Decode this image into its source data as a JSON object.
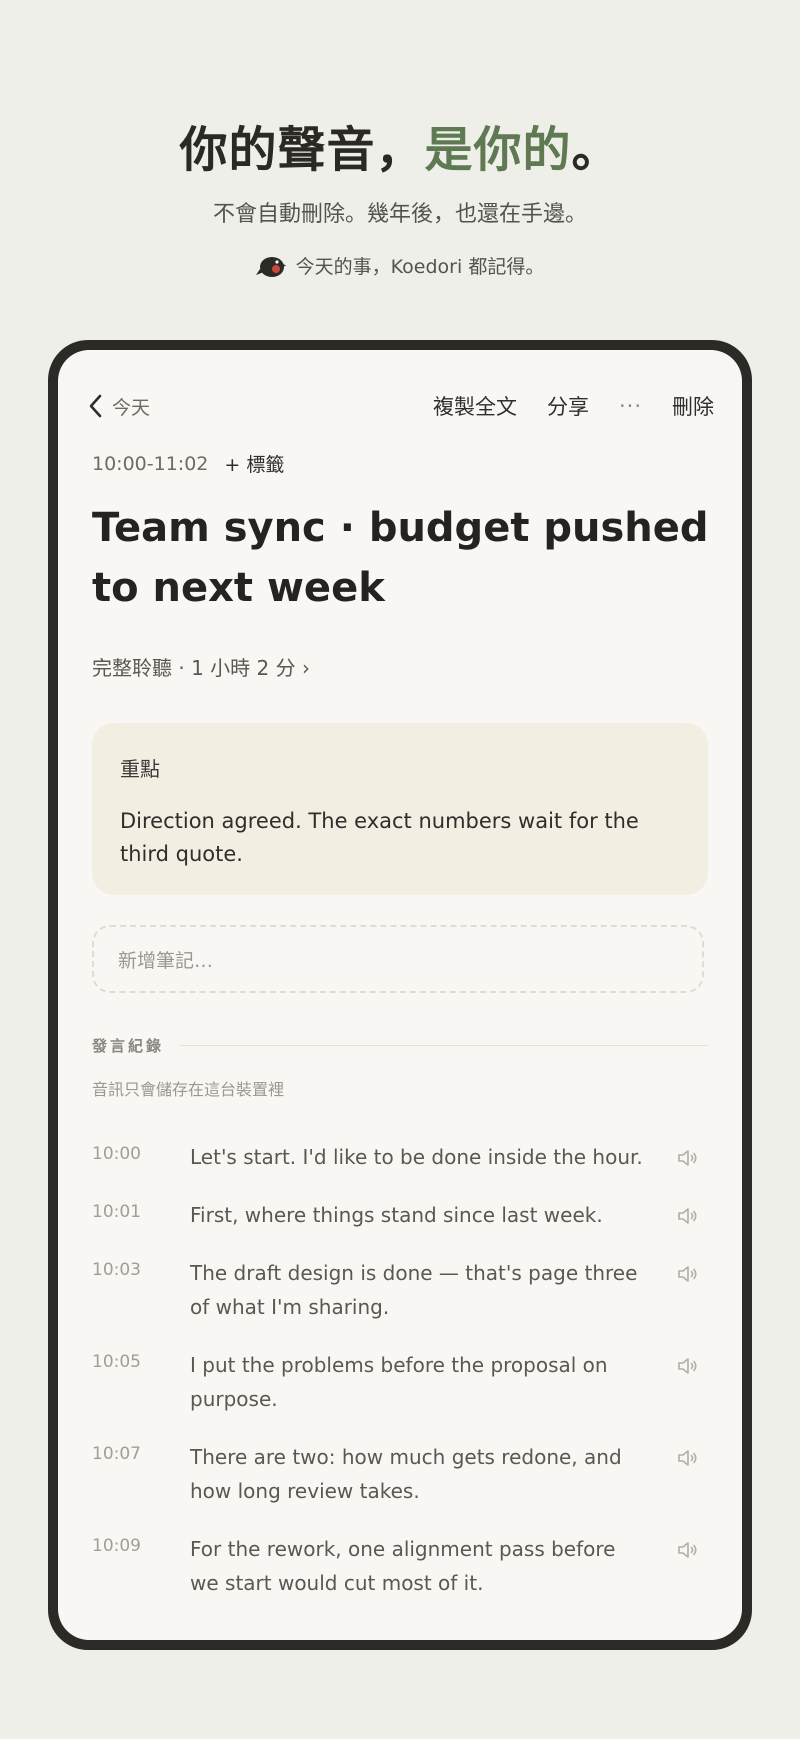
{
  "hero": {
    "title_main": "你的聲音，",
    "title_accent": "是你的",
    "title_end": "。",
    "subtitle": "不會自動刪除。幾年後，也還在手邊。",
    "tagline": "今天的事，Koedori 都記得。"
  },
  "topbar": {
    "back_label": "今天",
    "copy_label": "複製全文",
    "share_label": "分享",
    "more_label": "···",
    "delete_label": "刪除"
  },
  "entry": {
    "time_range": "10:00-11:02",
    "tag_label": "+ 標籤",
    "title": "Team sync · budget pushed to next week",
    "listen_label": "完整聆聽 · 1 小時 2 分 ›"
  },
  "highlight": {
    "label": "重點",
    "body": "Direction agreed. The exact numbers wait for the third quote."
  },
  "note": {
    "placeholder": "新增筆記…"
  },
  "transcript": {
    "heading": "發言紀錄",
    "storage_note": "音訊只會儲存在這台裝置裡",
    "items": [
      {
        "time": "10:00",
        "text": "Let's start. I'd like to be done inside the hour."
      },
      {
        "time": "10:01",
        "text": "First, where things stand since last week."
      },
      {
        "time": "10:03",
        "text": "The draft design is done — that's page three of what I'm sharing."
      },
      {
        "time": "10:05",
        "text": "I put the problems before the proposal on purpose."
      },
      {
        "time": "10:07",
        "text": "There are two: how much gets redone, and how long review takes."
      },
      {
        "time": "10:09",
        "text": "For the rework, one alignment pass before we start would cut most of it."
      }
    ]
  },
  "colors": {
    "accent": "#5f7a52",
    "highlight_bg": "#f3eee2",
    "frame": "#2b2a27"
  },
  "icons": {
    "back": "chevron-left-icon",
    "speaker": "speaker-icon",
    "logo": "bird-icon"
  }
}
